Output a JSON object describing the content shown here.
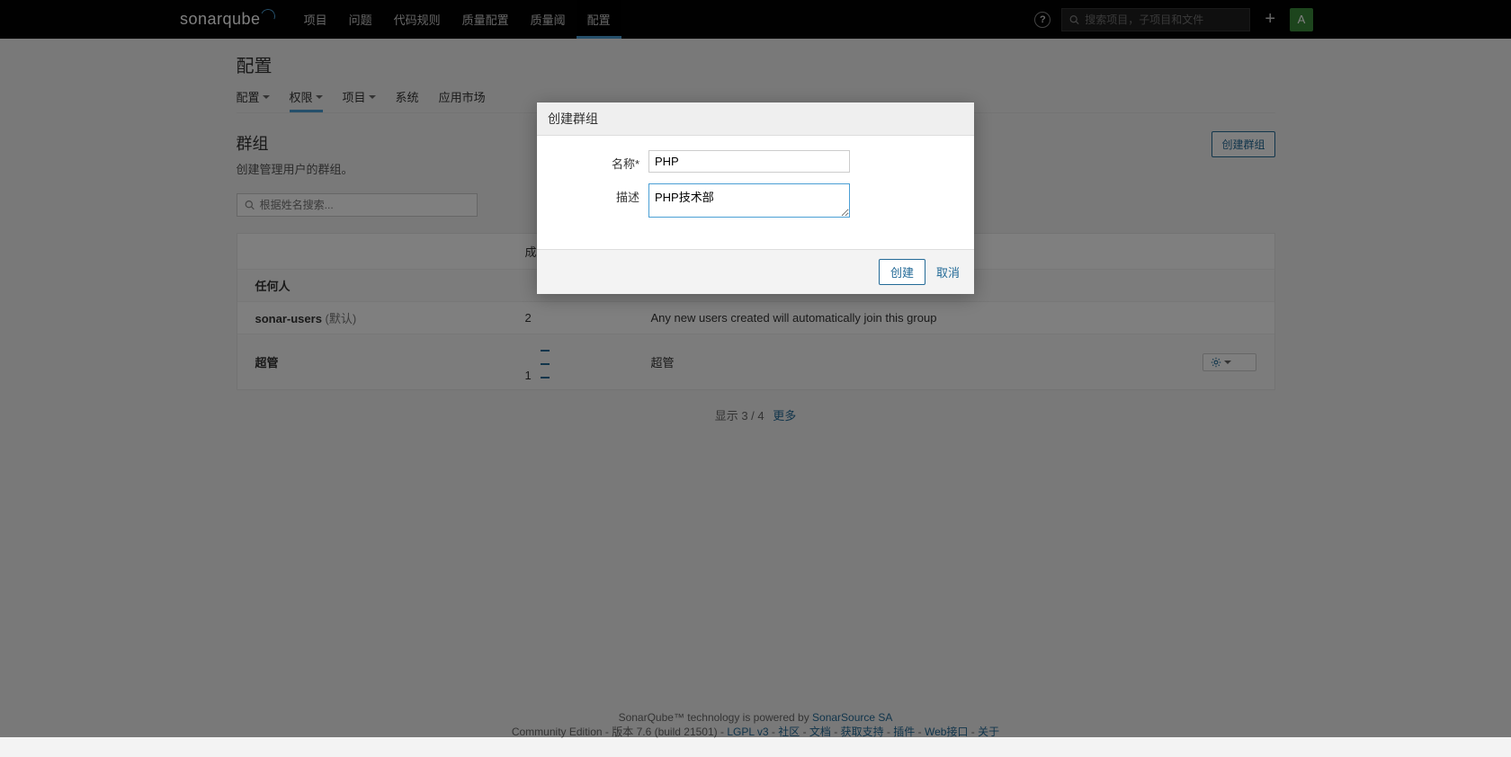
{
  "brand": "sonarqube",
  "nav": [
    "项目",
    "问题",
    "代码规则",
    "质量配置",
    "质量阈",
    "配置"
  ],
  "nav_active": 5,
  "search_placeholder": "搜索项目，子项目和文件",
  "avatar": "A",
  "page_title": "配置",
  "subnav": [
    "配置",
    "权限",
    "项目",
    "系统",
    "应用市场"
  ],
  "subnav_caret": [
    true,
    true,
    true,
    false,
    false
  ],
  "subnav_active": 1,
  "section": {
    "title": "群组",
    "sub": "创建管理用户的群组。",
    "create_btn": "创建群组"
  },
  "filter_placeholder": "根据姓名搜索...",
  "thead": {
    "c2": "成"
  },
  "rows": [
    {
      "name": "任何人",
      "default": "",
      "members": "",
      "desc": "",
      "gear": false,
      "alt": false
    },
    {
      "name": "sonar-users",
      "default": "(默认)",
      "members": "2",
      "desc": "Any new users created will automatically join this group",
      "gear": false,
      "alt": true
    },
    {
      "name": "超管",
      "default": "",
      "members": "1",
      "members_icon": true,
      "desc": "超管",
      "gear": true,
      "alt": false
    }
  ],
  "pager": {
    "text": "显示 3 / 4",
    "more": "更多"
  },
  "footer": {
    "line1_a": "SonarQube™ technology is powered by ",
    "line1_b": "SonarSource SA",
    "edition": "Community Edition",
    "version": "版本 7.6 (build 21501)",
    "links": [
      "LGPL v3",
      "社区",
      "文档",
      "获取支持",
      "插件",
      "Web接口",
      "关于"
    ]
  },
  "modal": {
    "title": "创建群组",
    "name_label": "名称*",
    "name_value": "PHP",
    "desc_label": "描述",
    "desc_value": "PHP技术部",
    "create": "创建",
    "cancel": "取消"
  }
}
